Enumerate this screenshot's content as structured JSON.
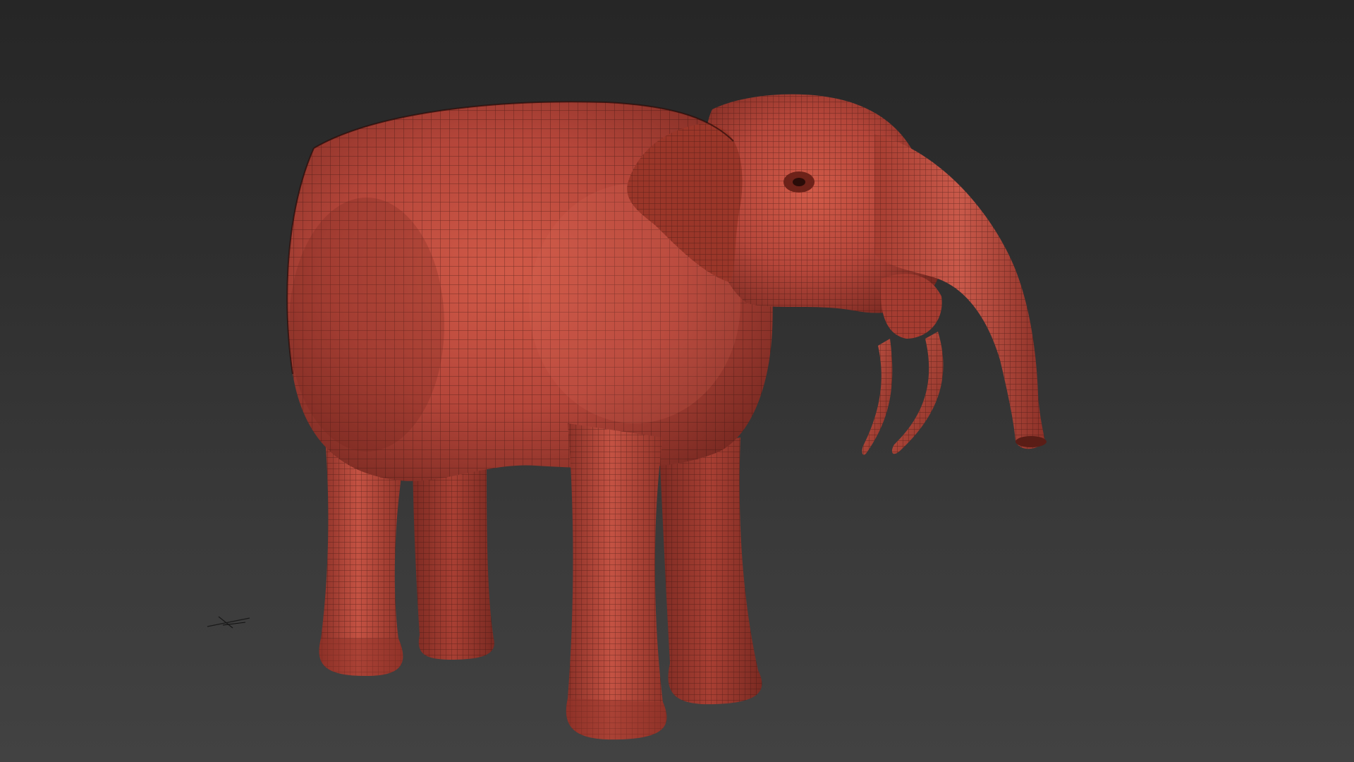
{
  "viewport": {
    "background_top": "#262626",
    "background_bottom": "#424242"
  },
  "model": {
    "subject": "elephant-mesh",
    "shading": "wireframe-on-shaded",
    "base_color": "#b8473a",
    "wire_color": "#3a1410"
  },
  "gizmo": {
    "icon": "axis-tripod-icon"
  }
}
